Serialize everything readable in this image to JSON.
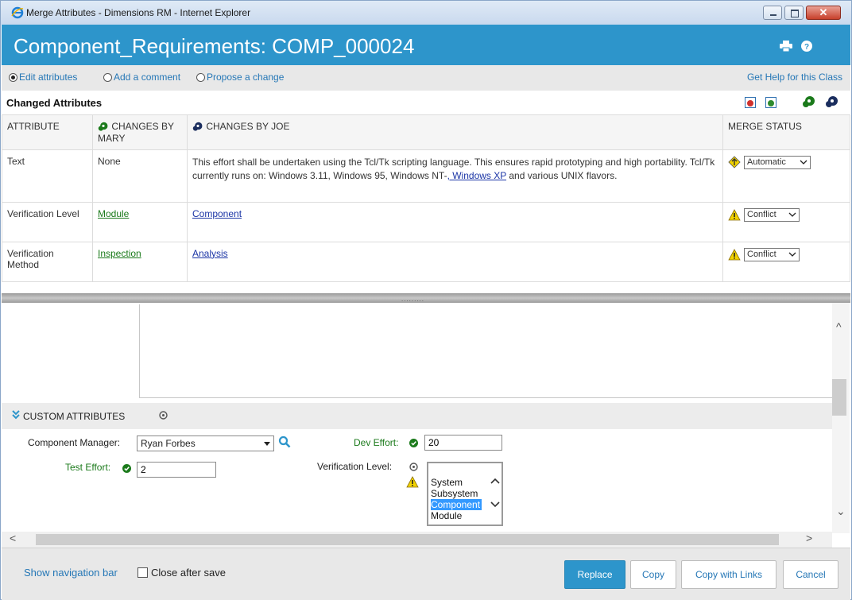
{
  "window": {
    "title": "Merge Attributes - Dimensions RM - Internet Explorer",
    "close_glyph": "✕"
  },
  "header": {
    "title": "Component_Requirements: COMP_000024",
    "icons": [
      "print-icon",
      "help-icon"
    ]
  },
  "mode": {
    "options": [
      "Edit attributes",
      "Add a comment",
      "Propose a change"
    ],
    "selected": "Edit attributes",
    "help_link": "Get Help for this Class"
  },
  "changed": {
    "title": "Changed Attributes",
    "toolbar_icons": [
      "accept-mary-icon",
      "accept-joe-icon",
      "mary-user-icon",
      "joe-user-icon"
    ]
  },
  "table": {
    "headers": {
      "attribute": "ATTRIBUTE",
      "mary": "CHANGES BY MARY",
      "joe": "CHANGES BY JOE",
      "status": "MERGE STATUS"
    },
    "rows": [
      {
        "attribute": "Text",
        "mary": "None",
        "joe_text": "This effort shall be undertaken using the Tcl/Tk scripting language. This ensures rapid prototyping and high portability. Tcl/Tk currently runs on: Windows 3.11, Windows 95, Windows NT-",
        "joe_link": ", Windows XP",
        "joe_tail": " and various UNIX flavors.",
        "status": "Automatic"
      },
      {
        "attribute": "Verification Level",
        "mary": "Module",
        "joe": "Component",
        "status": "Conflict"
      },
      {
        "attribute": "Verification Method",
        "mary": "Inspection",
        "joe": "Analysis",
        "status": "Conflict"
      }
    ]
  },
  "splitter": {
    "grip": "........."
  },
  "custom": {
    "title": "CUSTOM ATTRIBUTES",
    "component_manager": {
      "label": "Component Manager:",
      "value": "Ryan Forbes"
    },
    "dev_effort": {
      "label": "Dev Effort:",
      "value": "20"
    },
    "test_effort": {
      "label": "Test Effort:",
      "value": "2"
    },
    "verification_level": {
      "label": "Verification Level:",
      "options": [
        "System",
        "Subsystem",
        "Component",
        "Module"
      ],
      "selected": "Component"
    }
  },
  "scroll_glyphs": {
    "up": "^",
    "down": "⌄",
    "left": "<",
    "right": ">"
  },
  "footer": {
    "nav_link": "Show navigation bar",
    "close_after_save": "Close after save",
    "buttons": {
      "replace": "Replace",
      "copy": "Copy",
      "copy_links": "Copy with Links",
      "cancel": "Cancel"
    }
  },
  "colors": {
    "accent": "#2d95cb",
    "link_blue": "#2577b6",
    "green": "#1b7a1b",
    "warning": "#f2d300"
  }
}
